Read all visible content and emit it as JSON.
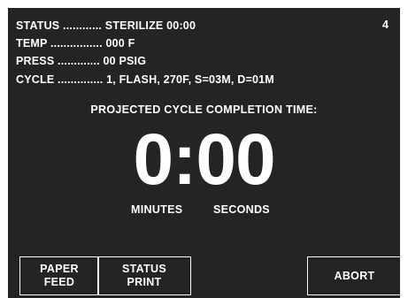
{
  "status": {
    "label": "STATUS ............",
    "value": "STERILIZE  00:00"
  },
  "temp": {
    "label": "TEMP ................",
    "value": "000 F"
  },
  "press": {
    "label": "PRESS .............",
    "value": "00  PSIG"
  },
  "cycle": {
    "label": "CYCLE ..............",
    "value": "1,  FLASH,  270F,  S=03M,  D=01M"
  },
  "page_number": "4",
  "projected_label": "PROJECTED  CYCLE  COMPLETION  TIME:",
  "timer": "0:00",
  "units": {
    "minutes": "MINUTES",
    "seconds": "SECONDS"
  },
  "buttons": {
    "paper_feed": "PAPER\nFEED",
    "status_print": "STATUS\nPRINT",
    "abort": "ABORT"
  },
  "colors": {
    "screen_bg": "#242424",
    "text": "#ffffff"
  }
}
